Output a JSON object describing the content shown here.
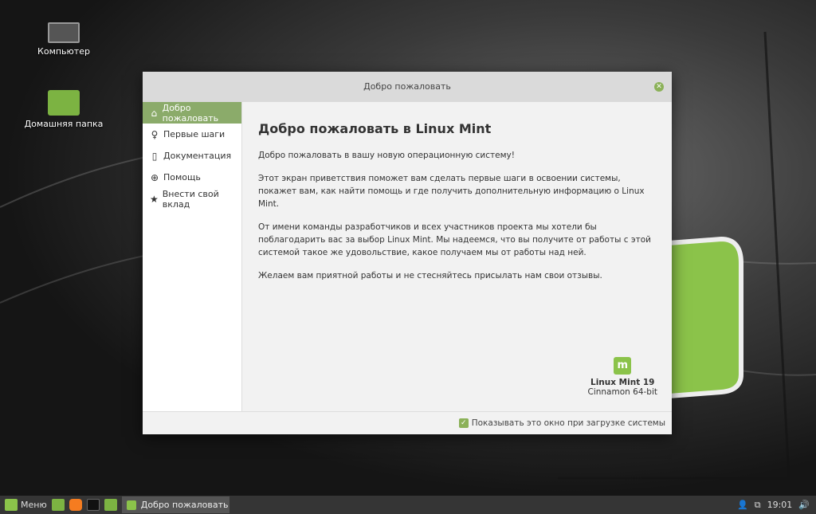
{
  "desktop": {
    "icons": [
      {
        "label": "Компьютер",
        "icon": "monitor-icon"
      },
      {
        "label": "Домашняя папка",
        "icon": "folder-icon"
      }
    ]
  },
  "window": {
    "title": "Добро пожаловать",
    "sidebar": [
      {
        "label": "Добро пожаловать",
        "icon": "home-icon"
      },
      {
        "label": "Первые шаги",
        "icon": "lightbulb-icon"
      },
      {
        "label": "Документация",
        "icon": "book-icon"
      },
      {
        "label": "Помощь",
        "icon": "lifebuoy-icon"
      },
      {
        "label": "Внести свой вклад",
        "icon": "star-icon"
      }
    ],
    "heading": "Добро пожаловать в Linux Mint",
    "paragraphs": [
      "Добро пожаловать в вашу новую операционную систему!",
      "Этот экран приветствия поможет вам сделать первые шаги в освоении системы, покажет вам, как найти помощь и где получить дополнительную информацию о Linux Mint.",
      "От имени команды разработчиков и всех участников проекта мы хотели бы поблагодарить вас за выбор Linux Mint. Мы надеемся, что вы получите от работы с этой системой такое же удовольствие, какое получаем мы от работы над ней.",
      "Желаем вам приятной работы и не стесняйтесь присылать нам свои отзывы."
    ],
    "version_name": "Linux Mint 19",
    "edition": "Cinnamon 64-bit",
    "show_on_startup": "Показывать это окно при загрузке системы",
    "show_on_startup_checked": true
  },
  "taskbar": {
    "menu": "Меню",
    "task": "Добро пожаловать",
    "clock": "19:01"
  },
  "colors": {
    "accent": "#8bab6a",
    "mint": "#8bc34a"
  }
}
